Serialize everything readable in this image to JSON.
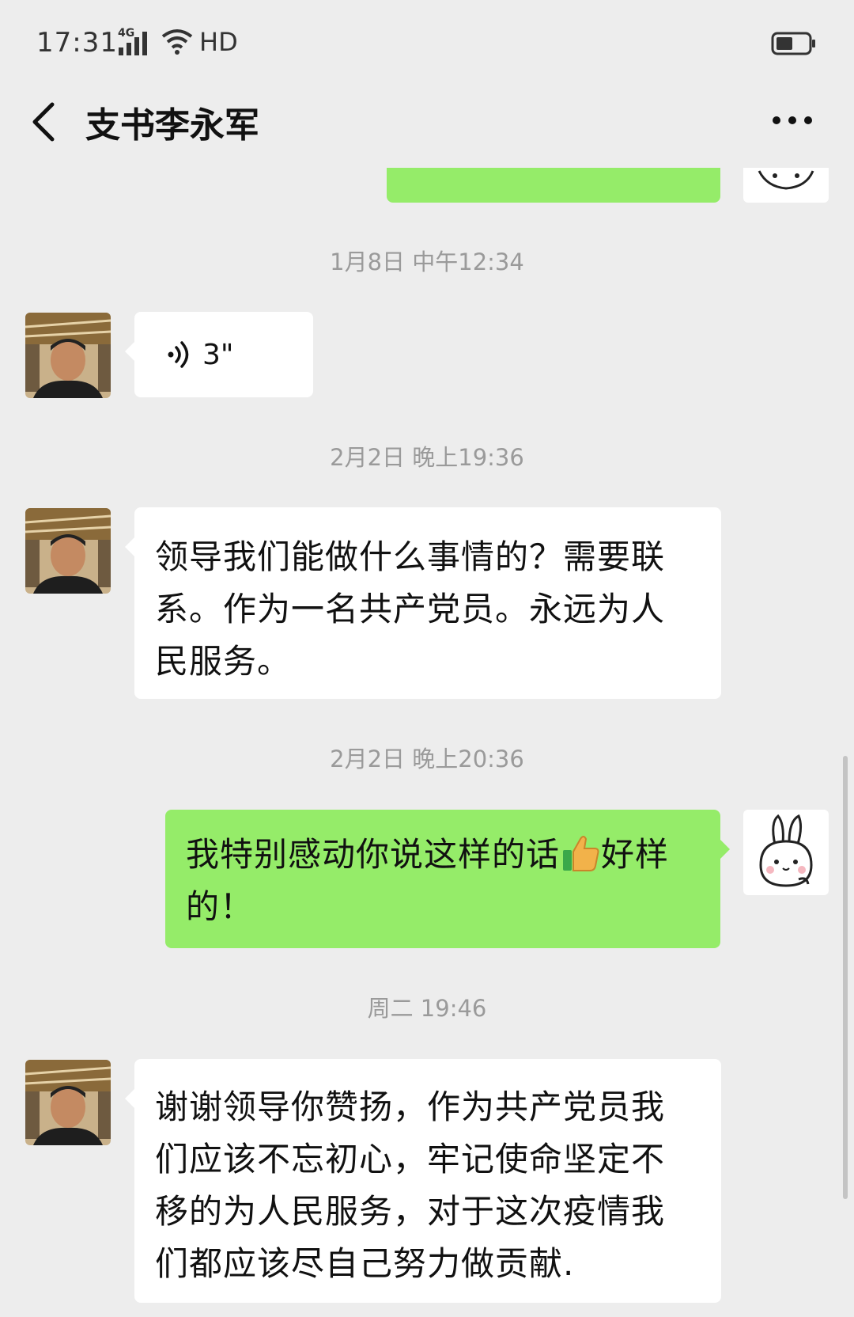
{
  "status_bar": {
    "time": "17:31",
    "network": "4G",
    "hd": "HD"
  },
  "header": {
    "title": "支书李永军",
    "back_icon": "chevron-left-icon",
    "more_icon": "more-horizontal-icon"
  },
  "messages": [
    {
      "type": "timestamp",
      "text": "1月8日 中午12:34"
    },
    {
      "type": "voice",
      "direction": "in",
      "duration": "3\""
    },
    {
      "type": "timestamp",
      "text": "2月2日 晚上19:36"
    },
    {
      "type": "text",
      "direction": "in",
      "lines": [
        "领导我们能做什么事情的？需要联",
        "系。作为一名共产党员。永远为人",
        "民服务。"
      ]
    },
    {
      "type": "timestamp",
      "text": "2月2日 晚上20:36"
    },
    {
      "type": "text",
      "direction": "out",
      "lines": [
        "我特别感动你说这样的话",
        "好样",
        "的！"
      ]
    },
    {
      "type": "timestamp",
      "text": "周二 19:46"
    },
    {
      "type": "text",
      "direction": "in",
      "lines": [
        "谢谢领导你赞扬，作为共产党员我",
        "们应该不忘初心，牢记使命坚定不",
        "移的为人民服务，对于这次疫情我",
        "们都应该尽自己努力做贡献."
      ]
    }
  ],
  "colors": {
    "background": "#ededed",
    "bubble_out": "#95ec69",
    "bubble_in": "#ffffff",
    "timestamp": "#9a9a9a"
  }
}
